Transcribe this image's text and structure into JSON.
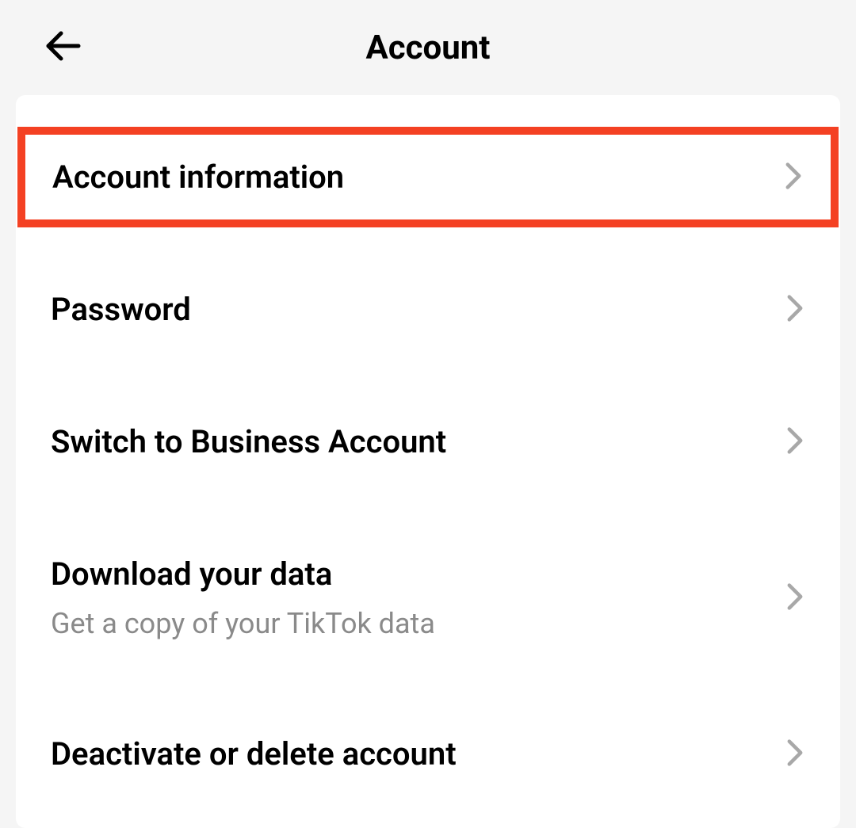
{
  "header": {
    "title": "Account"
  },
  "items": [
    {
      "label": "Account information",
      "highlighted": true
    },
    {
      "label": "Password"
    },
    {
      "label": "Switch to Business Account"
    },
    {
      "label": "Download your data",
      "subtitle": "Get a copy of your TikTok data"
    },
    {
      "label": "Deactivate or delete account"
    }
  ]
}
